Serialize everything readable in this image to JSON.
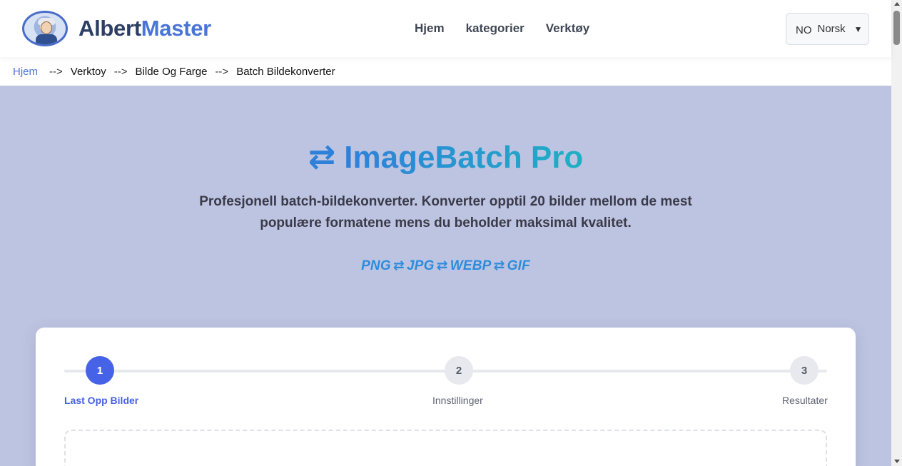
{
  "header": {
    "logo_text_a": "Albert",
    "logo_text_b": "Master",
    "nav": [
      "Hjem",
      "kategorier",
      "Verktøy"
    ],
    "lang_code": "NO",
    "lang_label": "Norsk",
    "lang_arrow": "▼"
  },
  "breadcrumb": {
    "items": [
      "Hjem",
      "Verktoy",
      "Bilde Og Farge",
      "Batch Bildekonverter"
    ],
    "separator": "-->"
  },
  "hero": {
    "icon": "⇄",
    "title": "ImageBatch Pro",
    "description": "Profesjonell batch-bildekonverter. Konverter opptil 20 bilder mellom de mest populære formatene mens du beholder maksimal kvalitet.",
    "formats": [
      "PNG",
      "JPG",
      "WEBP",
      "GIF"
    ],
    "swap_icon": "⇄"
  },
  "steps": [
    {
      "number": "1",
      "label": "Last Opp Bilder"
    },
    {
      "number": "2",
      "label": "Innstillinger"
    },
    {
      "number": "3",
      "label": "Resultater"
    }
  ],
  "colors": {
    "accent": "#4662e6",
    "hero_bg": "#bdc4e1",
    "brand": "#4a74d6"
  }
}
